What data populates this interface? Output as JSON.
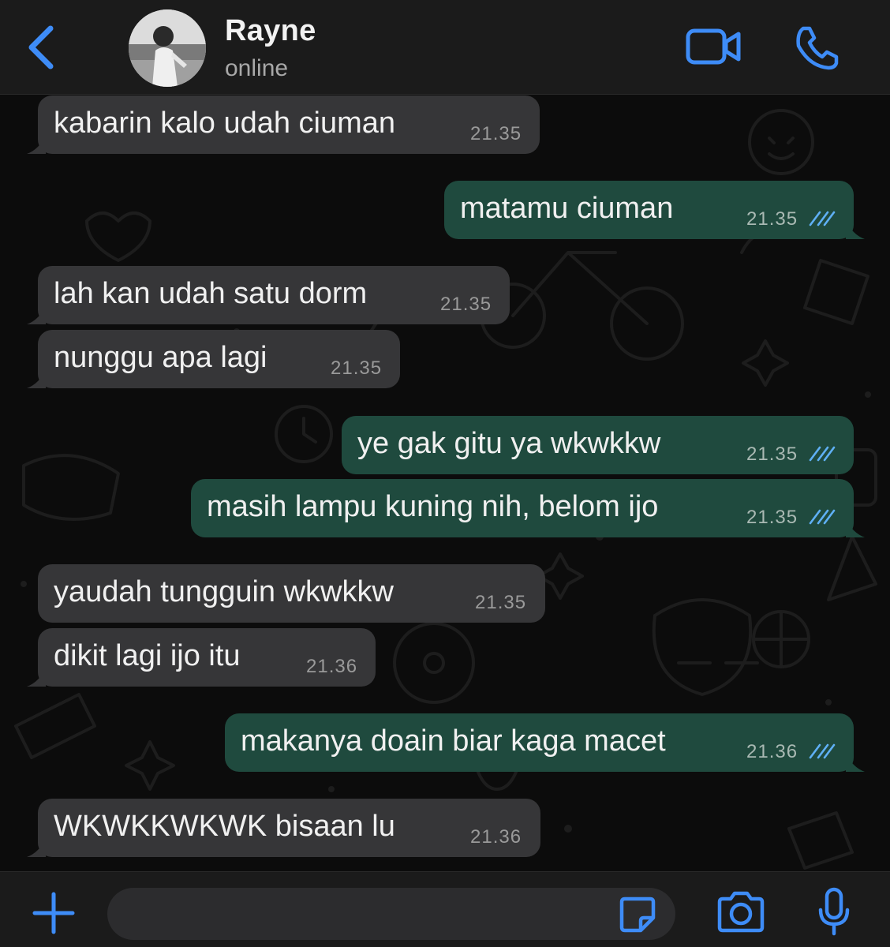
{
  "header": {
    "back_icon": "chevron-left-icon",
    "contact_name": "Rayne",
    "status": "online",
    "video_icon": "video-camera-icon",
    "call_icon": "phone-icon",
    "accent_color": "#3e8cf7"
  },
  "messages": [
    {
      "direction": "in",
      "text": "kabarin kalo udah ciuman",
      "time": "21.35"
    },
    {
      "direction": "out",
      "text": "matamu ciuman",
      "time": "21.35",
      "read": true
    },
    {
      "direction": "in",
      "text": "lah kan udah satu dorm",
      "time": "21.35"
    },
    {
      "direction": "in",
      "text": "nunggu apa lagi",
      "time": "21.35"
    },
    {
      "direction": "out",
      "text": "ye gak gitu ya wkwkkw",
      "time": "21.35",
      "read": true
    },
    {
      "direction": "out",
      "text": "masih lampu kuning nih, belom ijo",
      "time": "21.35",
      "read": true
    },
    {
      "direction": "in",
      "text": "yaudah tungguin wkwkkw",
      "time": "21.35"
    },
    {
      "direction": "in",
      "text": "dikit lagi ijo itu",
      "time": "21.36"
    },
    {
      "direction": "out",
      "text": "makanya doain biar kaga macet",
      "time": "21.36",
      "read": true
    },
    {
      "direction": "in",
      "text": "WKWKKWKWK bisaan lu",
      "time": "21.36"
    }
  ],
  "composer": {
    "plus_icon": "plus-icon",
    "input_value": "",
    "input_placeholder": "",
    "sticker_icon": "sticker-icon",
    "camera_icon": "camera-icon",
    "mic_icon": "microphone-icon"
  },
  "colors": {
    "incoming_bubble": "#363638",
    "outgoing_bubble": "#1f4a3e",
    "read_tick": "#5fb0f5"
  }
}
